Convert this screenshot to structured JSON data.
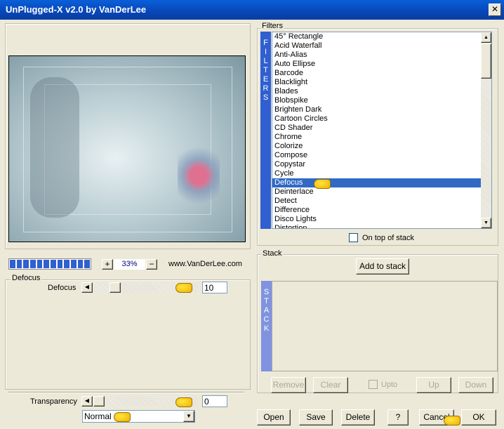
{
  "window": {
    "title": "UnPlugged-X v2.0 by VanDerLee",
    "close": "✕"
  },
  "preview": {
    "zoom": "33%",
    "zoom_in": "+",
    "zoom_out": "−",
    "url": "www.VanDerLee.com",
    "progress_segments": 12
  },
  "filter_group": {
    "label": "Defocus",
    "param_label": "Defocus",
    "param_value": "10",
    "slider_fraction": 0.1
  },
  "transparency": {
    "label": "Transparency",
    "value": "0",
    "mode": "Normal"
  },
  "filters": {
    "label": "Filters",
    "bar_text": "FILTERS",
    "selected": "Defocus",
    "items": [
      "45° Rectangle",
      "Acid Waterfall",
      "Anti-Alias",
      "Auto Ellipse",
      "Barcode",
      "Blacklight",
      "Blades",
      "Blobspike",
      "Brighten Dark",
      "Cartoon Circles",
      "CD Shader",
      "Chrome",
      "Colorize",
      "Compose",
      "Copystar",
      "Cycle",
      "Defocus",
      "Deinterlace",
      "Detect",
      "Difference",
      "Disco Lights",
      "Distortion"
    ],
    "on_top": "On top of stack"
  },
  "stack": {
    "label": "Stack",
    "bar_text": "STACK",
    "add": "Add to stack",
    "remove": "Remove",
    "clear": "Clear",
    "upto": "Upto",
    "up": "Up",
    "down": "Down"
  },
  "buttons": {
    "open": "Open",
    "save": "Save",
    "delete": "Delete",
    "help": "?",
    "cancel": "Cancel",
    "ok": "OK"
  },
  "colors": {
    "title": "#0a4fc8",
    "selection": "#316ac5",
    "bar": "#2f5fd0"
  }
}
